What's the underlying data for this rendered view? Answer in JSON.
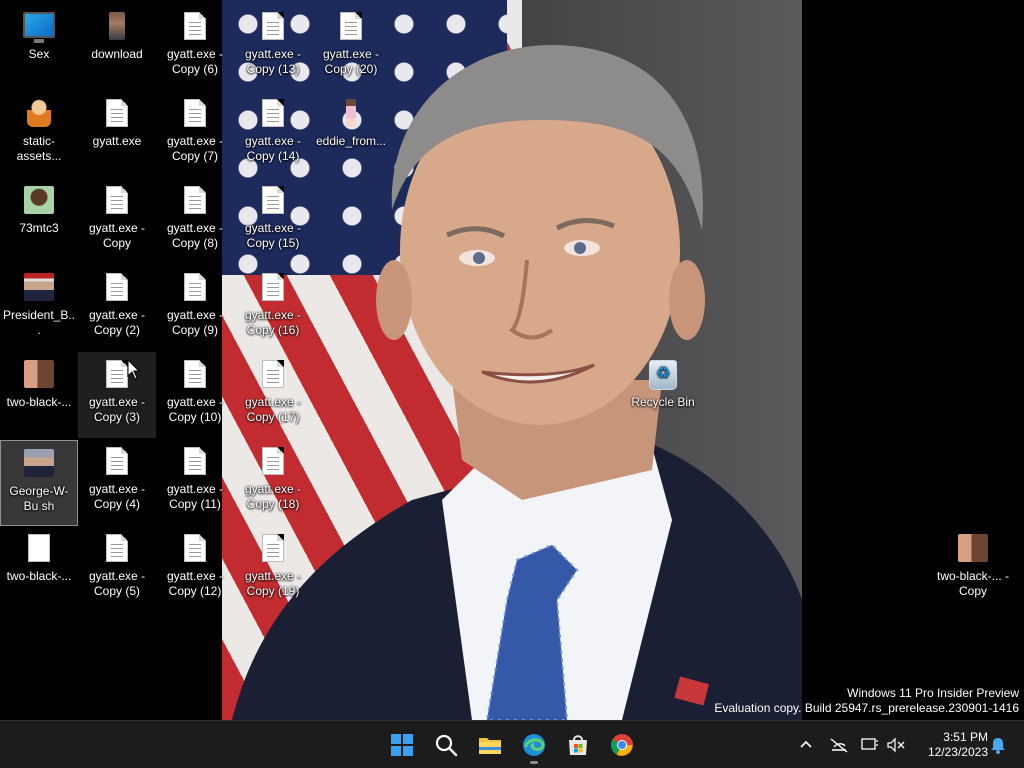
{
  "desktop": {
    "icons": [
      {
        "label": "Sex"
      },
      {
        "label": "download"
      },
      {
        "label": "gyatt.exe - Copy (6)"
      },
      {
        "label": "gyatt.exe - Copy (13)"
      },
      {
        "label": "gyatt.exe - Copy (20)"
      },
      {
        "label": "static-assets..."
      },
      {
        "label": "gyatt.exe"
      },
      {
        "label": "gyatt.exe - Copy (7)"
      },
      {
        "label": "gyatt.exe - Copy (14)"
      },
      {
        "label": "eddie_from..."
      },
      {
        "label": "73mtc3"
      },
      {
        "label": "gyatt.exe - Copy"
      },
      {
        "label": "gyatt.exe - Copy (8)"
      },
      {
        "label": "gyatt.exe - Copy (15)"
      },
      {
        "label": "President_B..."
      },
      {
        "label": "gyatt.exe - Copy (2)"
      },
      {
        "label": "gyatt.exe - Copy (9)"
      },
      {
        "label": "gyatt.exe - Copy (16)"
      },
      {
        "label": "two-black-..."
      },
      {
        "label": "gyatt.exe - Copy (3)"
      },
      {
        "label": "gyatt.exe - Copy (10)"
      },
      {
        "label": "gyatt.exe - Copy (17)"
      },
      {
        "label": "Recycle Bin"
      },
      {
        "label": "George-W-Bu sh"
      },
      {
        "label": "gyatt.exe - Copy (4)"
      },
      {
        "label": "gyatt.exe - Copy (11)"
      },
      {
        "label": "gyatt.exe - Copy (18)"
      },
      {
        "label": "two-black-..."
      },
      {
        "label": "gyatt.exe - Copy (5)"
      },
      {
        "label": "gyatt.exe - Copy (12)"
      },
      {
        "label": "gyatt.exe - Copy (19)"
      },
      {
        "label": "two-black-... - Copy"
      }
    ]
  },
  "watermark": {
    "line1": "Windows 11 Pro Insider Preview",
    "line2": "Evaluation copy. Build 25947.rs_prerelease.230901-1416"
  },
  "taskbar": {
    "apps": [
      "start-icon",
      "search-icon",
      "file-explorer-icon",
      "edge-icon",
      "store-icon",
      "chrome-icon"
    ],
    "clock": {
      "time": "3:51 PM",
      "date": "12/23/2023"
    },
    "tray": [
      "chevron-up-icon",
      "network-off-icon",
      "display-icon",
      "volume-muted-icon",
      "notification-bell-icon"
    ]
  },
  "colors": {
    "taskbar_bg": "#1c1c1c",
    "accent": "#0078d4"
  }
}
